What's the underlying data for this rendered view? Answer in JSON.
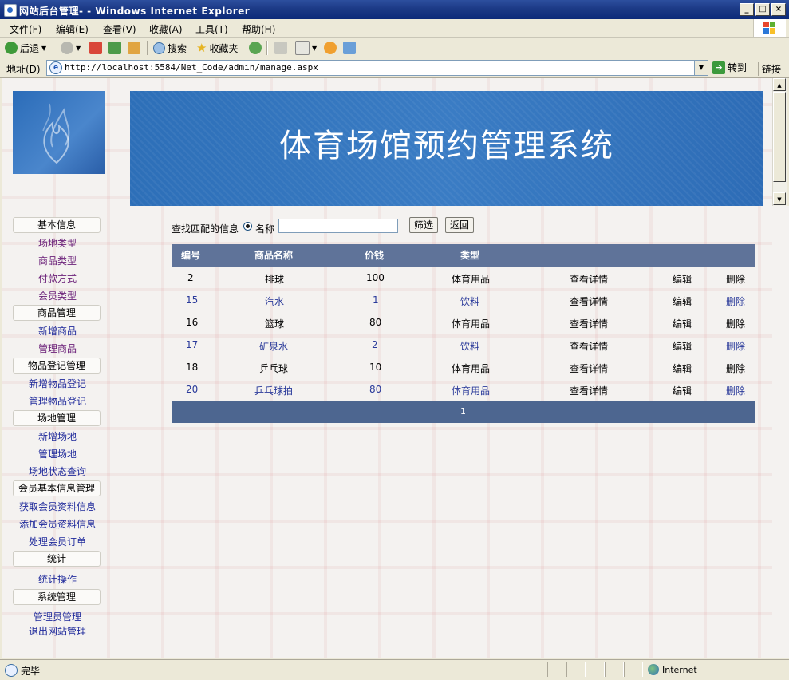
{
  "window": {
    "title": "网站后台管理- - Windows Internet Explorer",
    "controls": {
      "minimize": "_",
      "maximize": "□",
      "close": "×"
    }
  },
  "menubar": {
    "items": [
      "文件(F)",
      "编辑(E)",
      "查看(V)",
      "收藏(A)",
      "工具(T)",
      "帮助(H)"
    ]
  },
  "toolbar": {
    "back_label": "后退",
    "search_label": "搜索",
    "favorites_label": "收藏夹"
  },
  "address": {
    "label": "地址(D)",
    "url": "http://localhost:5584/Net_Code/admin/manage.aspx",
    "go_label": "转到",
    "links_label": "链接"
  },
  "banner": {
    "title": "体育场馆预约管理系统"
  },
  "nav": {
    "sections": [
      {
        "header": "基本信息",
        "links": [
          "场地类型",
          "商品类型",
          "付款方式",
          "会员类型"
        ]
      },
      {
        "header": "商品管理",
        "links": [
          "新增商品",
          "管理商品"
        ]
      },
      {
        "header": "物品登记管理",
        "links": [
          "新增物品登记",
          "管理物品登记"
        ]
      },
      {
        "header": "场地管理",
        "links": [
          "新增场地",
          "管理场地",
          "场地状态查询"
        ]
      },
      {
        "header": "会员基本信息管理",
        "links": [
          "获取会员资料信息",
          "添加会员资料信息",
          "处理会员订单"
        ]
      },
      {
        "header": "统计",
        "links": [
          "统计操作"
        ]
      },
      {
        "header": "系统管理",
        "links": [
          "管理员管理",
          "退出网站管理"
        ]
      }
    ]
  },
  "search": {
    "label": "查找匹配的信息",
    "radio_label": "名称",
    "value": "",
    "filter_button": "筛选",
    "back_button": "返回"
  },
  "grid": {
    "columns": [
      "编号",
      "商品名称",
      "价钱",
      "类型"
    ],
    "rows": [
      {
        "id": "2",
        "name": "排球",
        "price": "100",
        "type": "体育用品",
        "detail": "查看详情",
        "edit": "编辑",
        "delete": "删除"
      },
      {
        "id": "15",
        "name": "汽水",
        "price": "1",
        "type": "饮料",
        "detail": "查看详情",
        "edit": "编辑",
        "delete": "删除"
      },
      {
        "id": "16",
        "name": "篮球",
        "price": "80",
        "type": "体育用品",
        "detail": "查看详情",
        "edit": "编辑",
        "delete": "删除"
      },
      {
        "id": "17",
        "name": "矿泉水",
        "price": "2",
        "type": "饮料",
        "detail": "查看详情",
        "edit": "编辑",
        "delete": "删除"
      },
      {
        "id": "18",
        "name": "乒乓球",
        "price": "10",
        "type": "体育用品",
        "detail": "查看详情",
        "edit": "编辑",
        "delete": "删除"
      },
      {
        "id": "20",
        "name": "乒乓球拍",
        "price": "80",
        "type": "体育用品",
        "detail": "查看详情",
        "edit": "编辑",
        "delete": "删除"
      }
    ],
    "pager": "1"
  },
  "status": {
    "text": "完毕",
    "zone": "Internet"
  },
  "colors": {
    "banner": "#3a7cc4",
    "grid_header": "#5f7399",
    "nav_link": "#6a1f78"
  }
}
